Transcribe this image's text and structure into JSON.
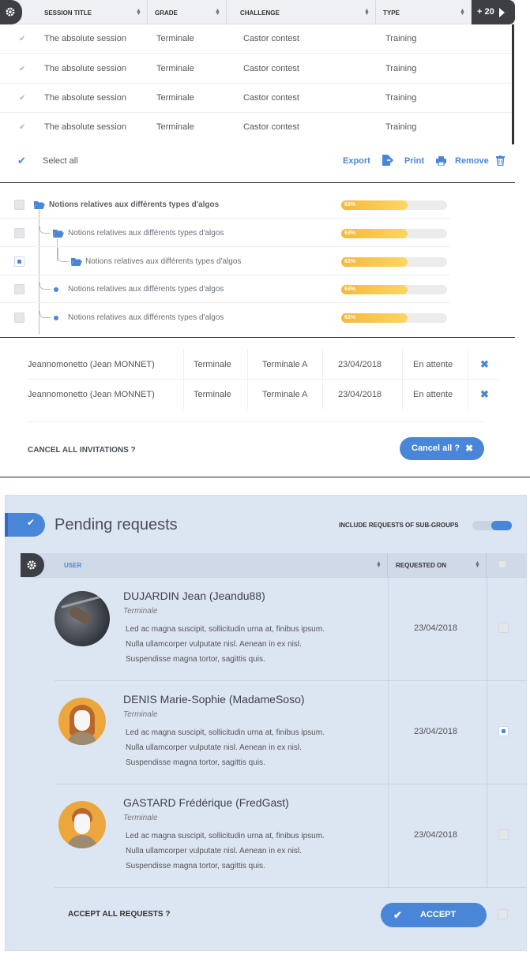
{
  "sessions": {
    "columns": [
      "SESSION TITLE",
      "GRADE",
      "CHALLENGE",
      "TYPE"
    ],
    "more_label": "+ 20",
    "rows": [
      {
        "title": "The absolute session",
        "grade": "Terminale",
        "challenge": "Castor contest",
        "type": "Training"
      },
      {
        "title": "The absolute session",
        "grade": "Terminale",
        "challenge": "Castor contest",
        "type": "Training"
      },
      {
        "title": "The absolute session",
        "grade": "Terminale",
        "challenge": "Castor contest",
        "type": "Training"
      },
      {
        "title": "The absolute session",
        "grade": "Terminale",
        "challenge": "Castor contest",
        "type": "Training"
      }
    ],
    "select_all": "Select all",
    "export": "Export",
    "print": "Print",
    "remove": "Remove"
  },
  "tree": {
    "items": [
      {
        "label": "Notions relatives aux différents types d'algos",
        "progress": 0.63,
        "pct": "63%",
        "checked": false
      },
      {
        "label": "Notions relatives aux différents types d'algos",
        "progress": 0.63,
        "pct": "63%",
        "checked": false
      },
      {
        "label": "Notions relatives aux différents types d'algos",
        "progress": 0.63,
        "pct": "63%",
        "checked": true
      },
      {
        "label": "Notions relatives aux différents types d'algos",
        "progress": 0.63,
        "pct": "63%",
        "checked": false
      },
      {
        "label": "Notions relatives aux différents types d'algos",
        "progress": 0.63,
        "pct": "63%",
        "checked": false
      }
    ]
  },
  "invitations": {
    "rows": [
      {
        "user": "Jeannomonetto (Jean MONNET)",
        "grade": "Terminale",
        "group": "Terminale A",
        "date": "23/04/2018",
        "status": "En attente"
      },
      {
        "user": "Jeannomonetto (Jean MONNET)",
        "grade": "Terminale",
        "group": "Terminale A",
        "date": "23/04/2018",
        "status": "En attente"
      }
    ],
    "cancel_all_label": "CANCEL ALL INVITATIONS ?",
    "cancel_all_button": "Cancel all ?"
  },
  "pending": {
    "title": "Pending requests",
    "include_label": "INCLUDE REQUESTS OF SUB-GROUPS",
    "col_user": "USER",
    "col_requested": "REQUESTED ON",
    "requests": [
      {
        "name": "DUJARDIN Jean (Jeandu88)",
        "grade": "Terminale",
        "desc": [
          "Led ac magna suscipit, sollicitudin urna at, finibus ipsum.",
          "Nulla ullamcorper vulputate nisl. Aenean in ex nisl.",
          "Suspendisse magna tortor, sagittis quis."
        ],
        "date": "23/04/2018",
        "checked": false
      },
      {
        "name": "DENIS Marie-Sophie (MadameSoso)",
        "grade": "Terminale",
        "desc": [
          "Led ac magna suscipit, sollicitudin urna at, finibus ipsum.",
          "Nulla ullamcorper vulputate nisl. Aenean in ex nisl.",
          "Suspendisse magna tortor, sagittis quis."
        ],
        "date": "23/04/2018",
        "checked": true
      },
      {
        "name": "GASTARD Frédérique (FredGast)",
        "grade": "Terminale",
        "desc": [
          "Led ac magna suscipit, sollicitudin urna at, finibus ipsum.",
          "Nulla ullamcorper vulputate nisl. Aenean in ex nisl.",
          "Suspendisse magna tortor, sagittis quis."
        ],
        "date": "23/04/2018",
        "checked": false
      }
    ],
    "accept_all_label": "ACCEPT ALL REQUESTS ?",
    "accept_button": "ACCEPT"
  },
  "colors": {
    "accent": "#4a86d8",
    "progress": "#f7c64d",
    "panel": "#dce5f2"
  }
}
